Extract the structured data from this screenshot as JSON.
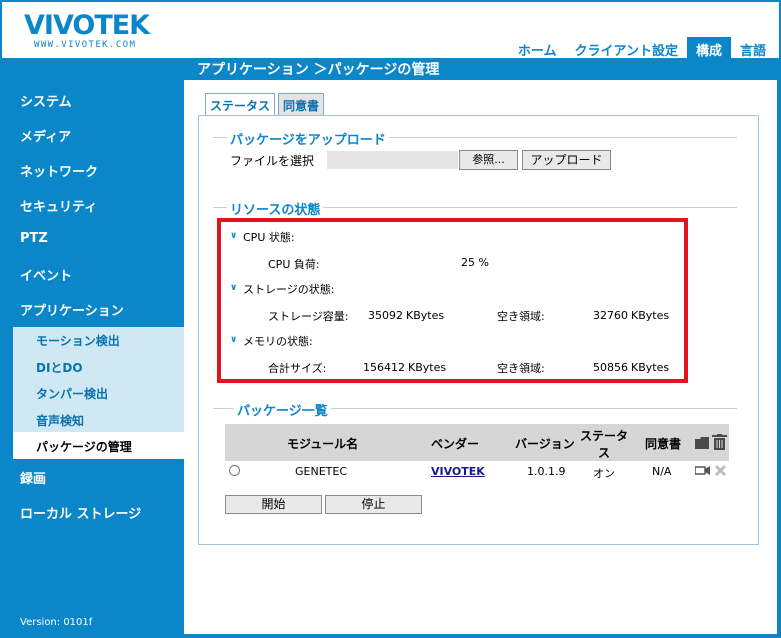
{
  "logo": {
    "name": "VIVOTEK",
    "url": "WWW.VIVOTEK.COM"
  },
  "top_nav": [
    {
      "label": "ホーム"
    },
    {
      "label": "クライアント設定"
    },
    {
      "label": "構成",
      "active": true
    },
    {
      "label": "言語"
    }
  ],
  "breadcrumb": "アプリケーション ＞パッケージの管理",
  "sidebar": {
    "items": [
      {
        "label": "システム"
      },
      {
        "label": "メディア"
      },
      {
        "label": "ネットワーク"
      },
      {
        "label": "セキュリティ"
      },
      {
        "label": "PTZ"
      },
      {
        "label": "イベント"
      },
      {
        "label": "アプリケーション"
      },
      {
        "label": "録画"
      },
      {
        "label": "ローカル ストレージ"
      }
    ],
    "sub_items": [
      {
        "label": "モーション検出"
      },
      {
        "label": "DIとDO"
      },
      {
        "label": "タンパー検出"
      },
      {
        "label": "音声検知"
      },
      {
        "label": "パッケージの管理",
        "active": true
      }
    ],
    "version": "Version: 0101f"
  },
  "tabs": [
    {
      "label": "ステータス",
      "active": true
    },
    {
      "label": "同意書"
    }
  ],
  "upload": {
    "title": "パッケージをアップロード",
    "file_label": "ファイルを選択",
    "browse_label": "参照...",
    "upload_label": "アップロード"
  },
  "resources": {
    "title": "リソースの状態",
    "cpu": {
      "heading": "CPU 状態:",
      "load_label": "CPU 負荷:",
      "load_value": "25 %"
    },
    "storage": {
      "heading": "ストレージの状態:",
      "capacity_label": "ストレージ容量:",
      "capacity_value": "35092",
      "capacity_unit": "KBytes",
      "free_label": "空き領域:",
      "free_value": "32760",
      "free_unit": "KBytes"
    },
    "memory": {
      "heading": "メモリの状態:",
      "total_label": "合計サイズ:",
      "total_value": "156412",
      "total_unit": "KBytes",
      "free_label": "空き領域:",
      "free_value": "50856",
      "free_unit": "KBytes"
    }
  },
  "packages": {
    "title": "パッケージ一覧",
    "headers": {
      "module": "モジュール名",
      "vendor": "ベンダー",
      "version": "バージョン",
      "status_line1": "ステータ",
      "status_line2": "ス",
      "agreement": "同意書"
    },
    "rows": [
      {
        "module": "GENETEC",
        "vendor": "VIVOTEK",
        "version": "1.0.1.9",
        "status": "オン",
        "agreement": "N/A"
      }
    ],
    "start_label": "開始",
    "stop_label": "停止"
  },
  "colors": {
    "brand_blue": "#0a86c9",
    "highlight_red": "#e3141d",
    "submenu_bg": "#d0e7f4"
  }
}
